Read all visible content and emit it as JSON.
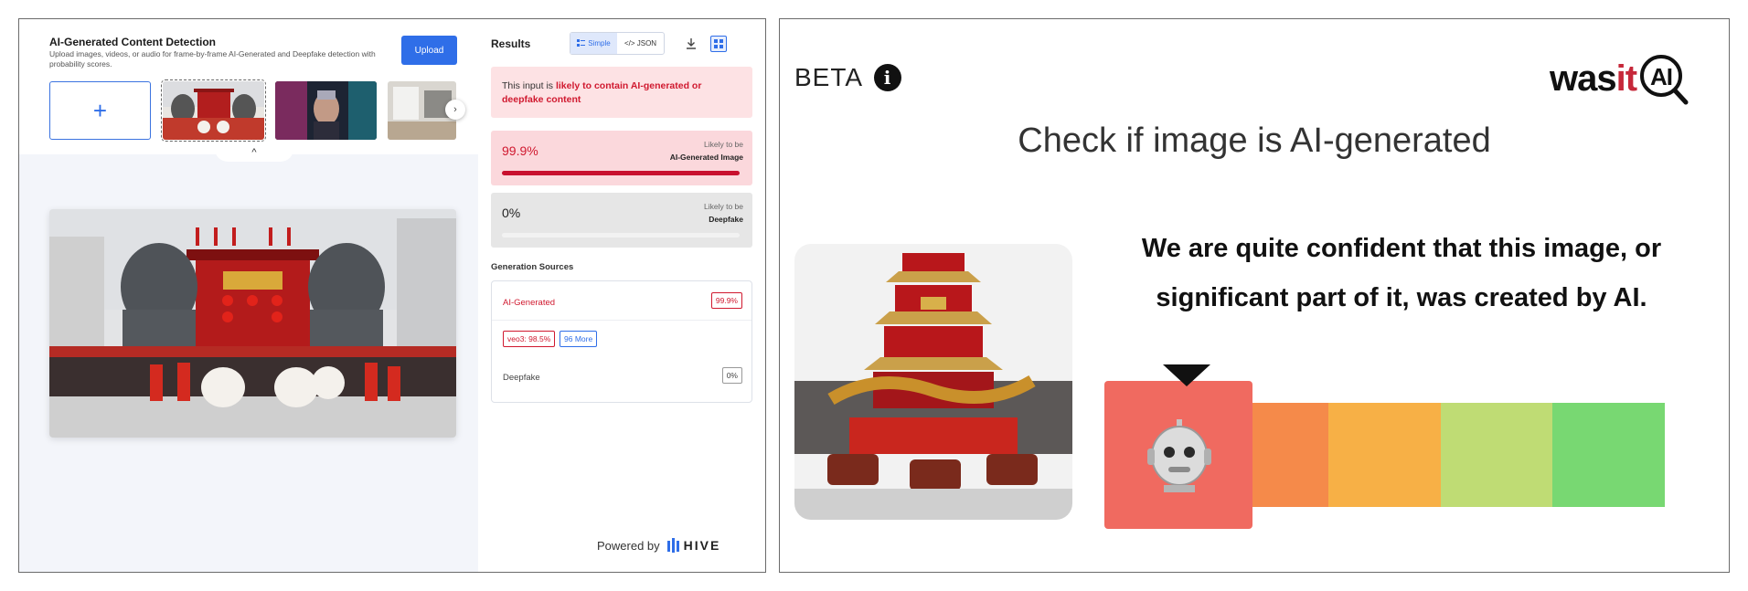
{
  "hive": {
    "app_title": "AI-Generated Content Detection",
    "app_subtitle": "Upload images, videos, or audio for frame-by-frame AI-Generated and Deepfake detection with probability scores.",
    "upload_label": "Upload",
    "add_symbol": "+",
    "next_symbol": "›",
    "collapse_symbol": "^",
    "results_title": "Results",
    "toggle": {
      "simple": "Simple",
      "json": "</> JSON"
    },
    "verdict": {
      "prefix": "This input is ",
      "emphasis": "likely to contain AI-generated or deepfake content"
    },
    "scores": [
      {
        "percent_text": "99.9%",
        "label_top": "Likely to be",
        "label_main": "AI-Generated Image",
        "fraction": 0.999
      },
      {
        "percent_text": "0%",
        "label_top": "Likely to be",
        "label_main": "Deepfake",
        "fraction": 0.0
      }
    ],
    "generation_sources_title": "Generation Sources",
    "sources": {
      "ai_label": "AI-Generated",
      "ai_value": "99.9%",
      "tag_model": "veo3: 98.5%",
      "tag_more": "96 More",
      "deepfake_label": "Deepfake",
      "deepfake_value": "0%"
    },
    "powered_by": "Powered by",
    "brand": "HIVE"
  },
  "wasit": {
    "beta_label": "BETA",
    "info_symbol": "i",
    "logo_was": "was",
    "logo_it": "it",
    "logo_ai": "AI",
    "headline": "Check if image is AI-generated",
    "verdict_line1": "We are quite confident that this image, or",
    "verdict_line2": "significant part of it, was created by AI.",
    "meter_colors": [
      "#f06a60",
      "#f58a4a",
      "#f7b046",
      "#bfdc74",
      "#78d872"
    ],
    "selected_level": 1
  }
}
